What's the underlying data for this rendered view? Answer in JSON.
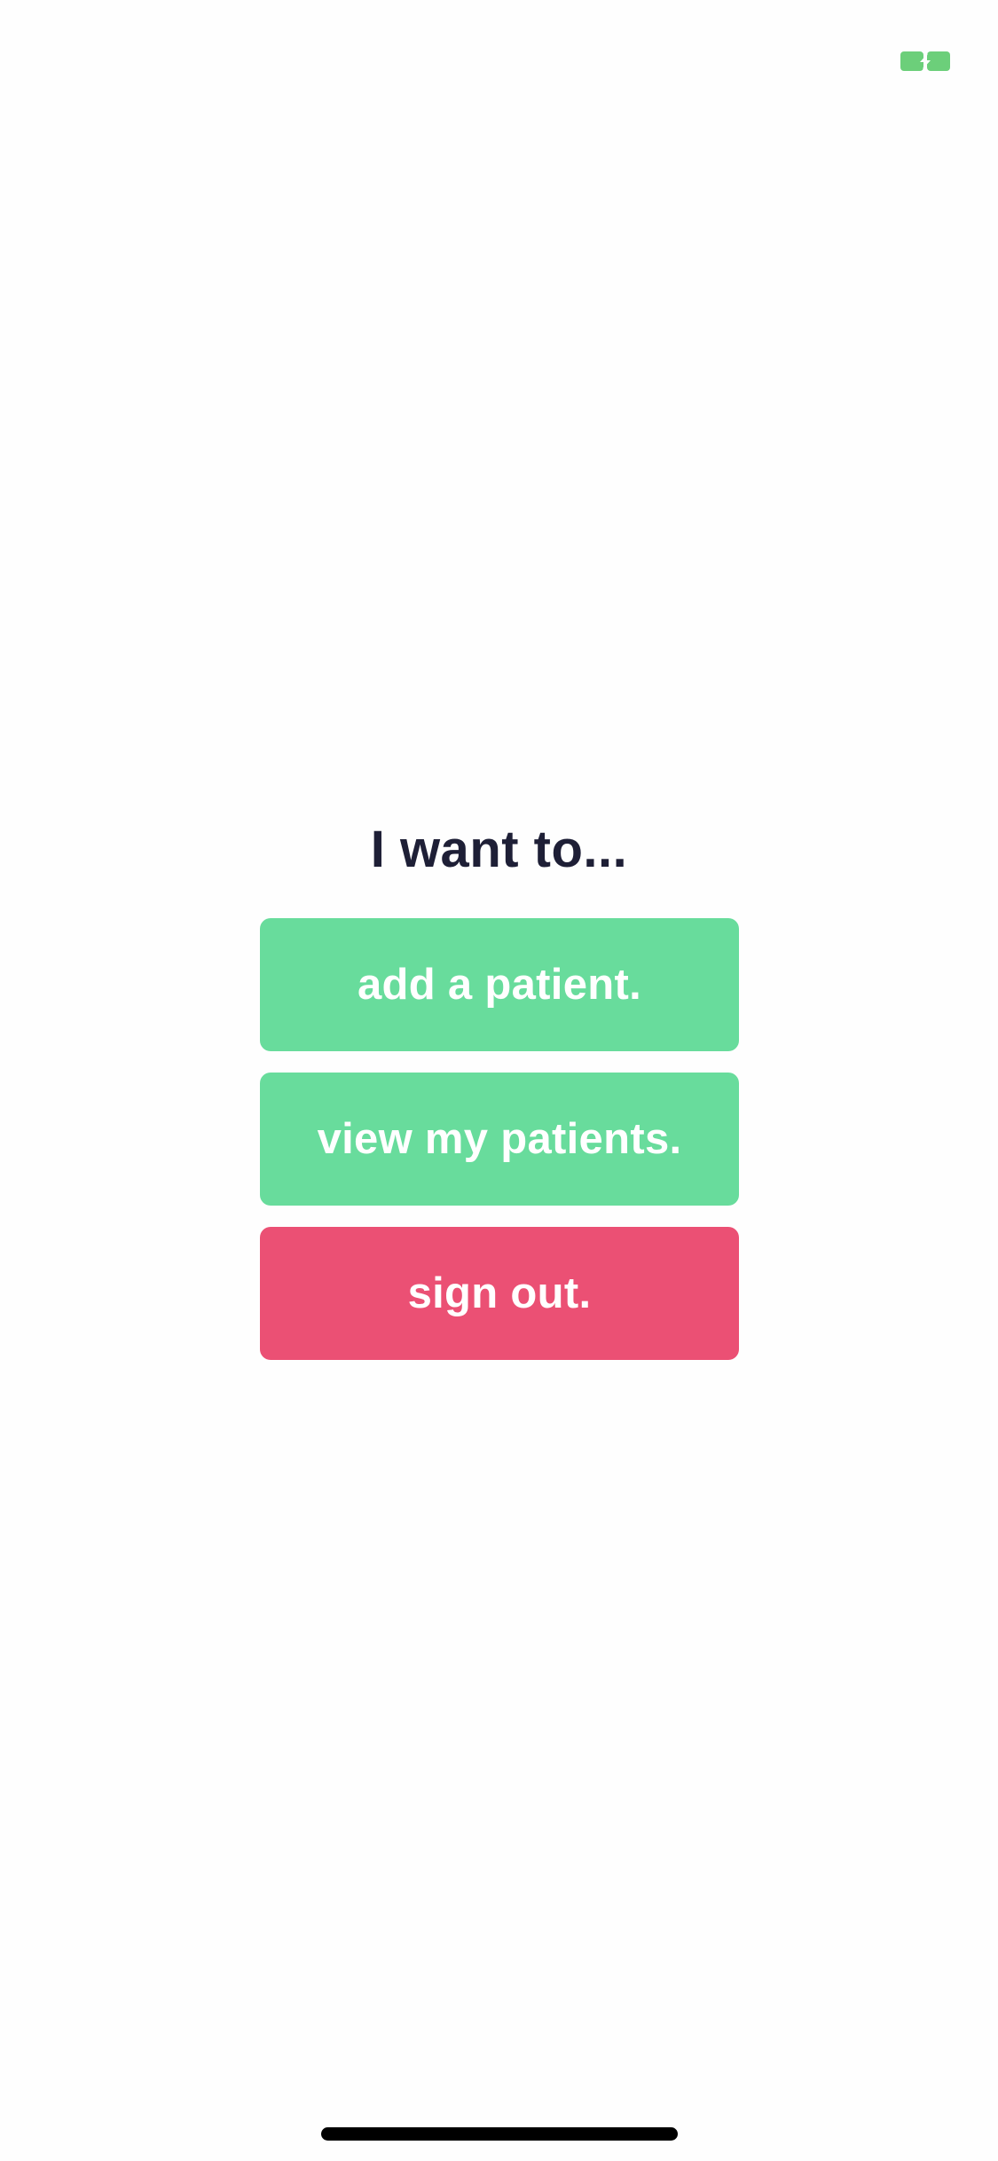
{
  "status_bar": {
    "battery_icon": "battery-charging-icon",
    "battery_color": "#6ccf7a"
  },
  "main": {
    "heading": "I want to...",
    "buttons": {
      "add_patient": "add a patient.",
      "view_patients": "view my patients.",
      "sign_out": "sign out."
    }
  },
  "colors": {
    "primary_green": "#68dc9c",
    "danger_red": "#eb5074",
    "heading_text": "#1e1f36",
    "background": "#fefefe"
  }
}
